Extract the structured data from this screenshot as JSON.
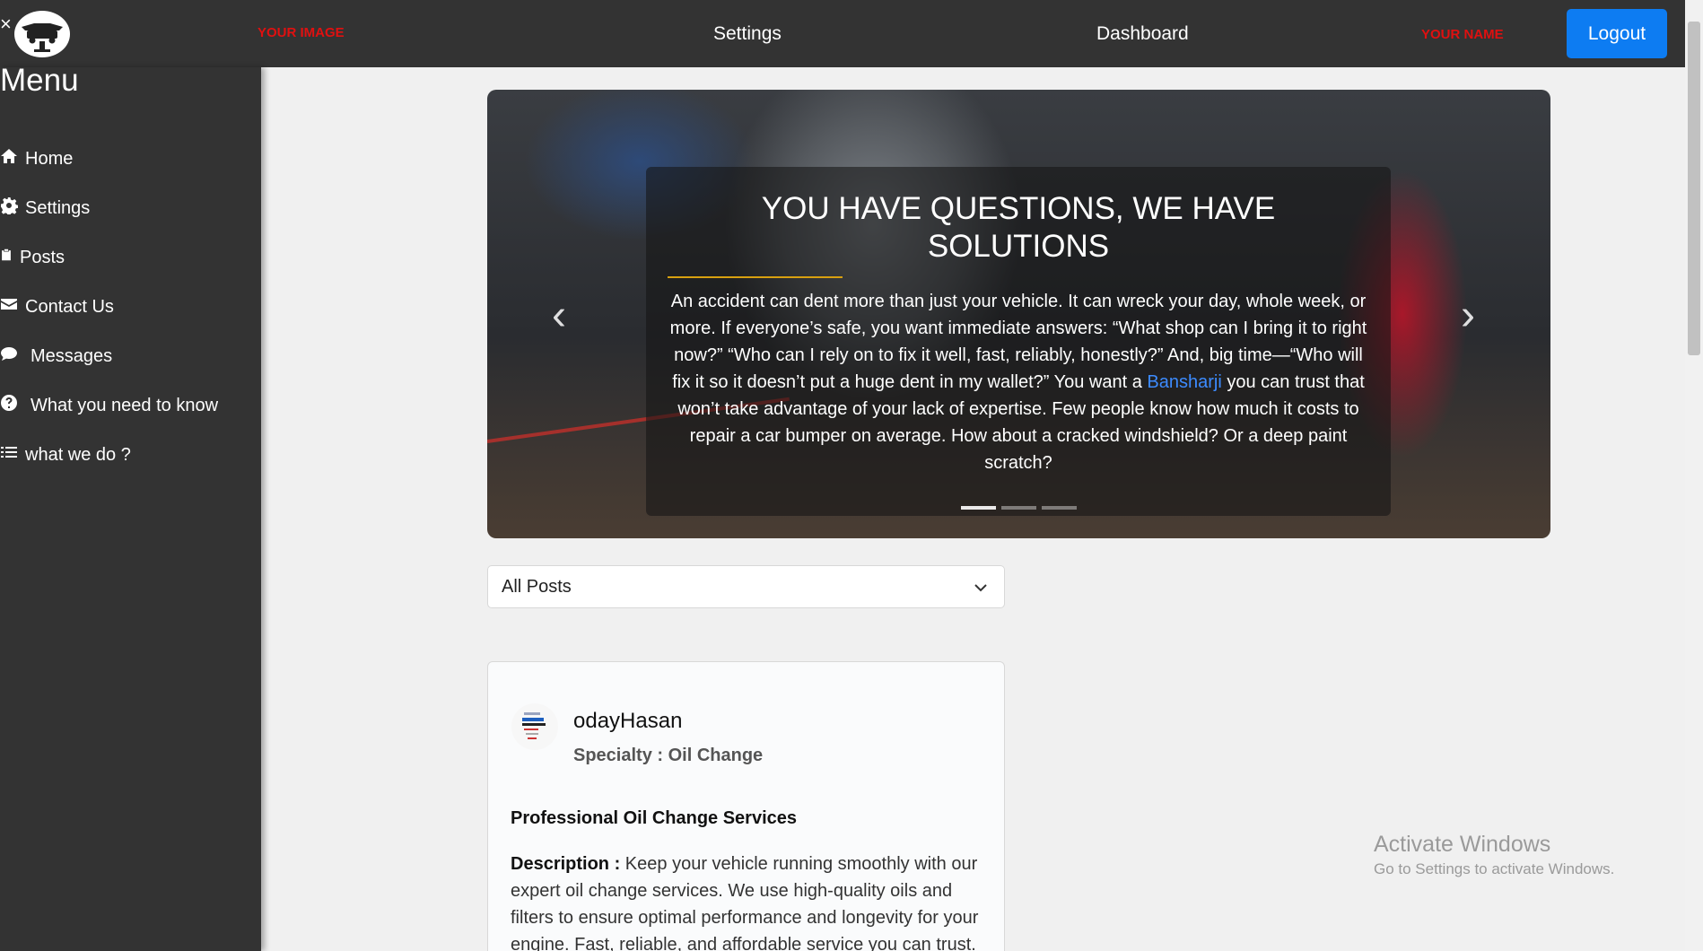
{
  "topbar": {
    "close_symbol": "×",
    "your_image": "YOUR IMAGE",
    "settings": "Settings",
    "dashboard": "Dashboard",
    "your_name": "YOUR NAME",
    "logout": "Logout"
  },
  "sidebar": {
    "title": "Menu",
    "items": [
      {
        "label": "Home",
        "icon": "home-icon"
      },
      {
        "label": "Settings",
        "icon": "gear-icon"
      },
      {
        "label": "Posts",
        "icon": "clipboard-icon"
      },
      {
        "label": "Contact Us",
        "icon": "envelope-icon"
      },
      {
        "label": "Messages",
        "icon": "comment-icon"
      },
      {
        "label": "What you need to know",
        "icon": "question-circle-icon"
      },
      {
        "label": "what we do ?",
        "icon": "list-icon"
      }
    ]
  },
  "carousel": {
    "title": "YOU HAVE QUESTIONS, WE HAVE SOLUTIONS",
    "text_before_link": "An accident can dent more than just your vehicle. It can wreck your day, whole week, or more. If everyone’s safe, you want immediate answers: “What shop can I bring it to right now?” “Who can I rely on to fix it well, fast, reliably, honestly?” And, big time—“Who will fix it so it doesn’t put a huge dent in my wallet?” You want a ",
    "link_text": "Bansharji",
    "text_after_link": " you can trust that won’t take advantage of your lack of expertise. Few people know how much it costs to repair a car bumper on average. How about a cracked windshield? Or a deep paint scratch?",
    "prev_arrow": "‹",
    "next_arrow": "›",
    "slide_count": 3,
    "active_slide": 1
  },
  "filter": {
    "selected": "All Posts"
  },
  "post": {
    "author": "odayHasan",
    "specialty": "Specialty : Oil Change",
    "title": "Professional Oil Change Services",
    "description_label": "Description :",
    "description": " Keep your vehicle running smoothly with our expert oil change services. We use high-quality oils and filters to ensure optimal performance and longevity for your engine. Fast, reliable, and affordable service you can trust."
  },
  "watermark": {
    "line1": "Activate Windows",
    "line2": "Go to Settings to activate Windows."
  },
  "colors": {
    "nav_bg": "#333333",
    "page_bg": "#f0f0f0",
    "logout_bg": "#0d7cf2",
    "placeholder_red": "#e01010",
    "accent_gold": "#d8a010",
    "link_blue": "#3d8bff"
  }
}
